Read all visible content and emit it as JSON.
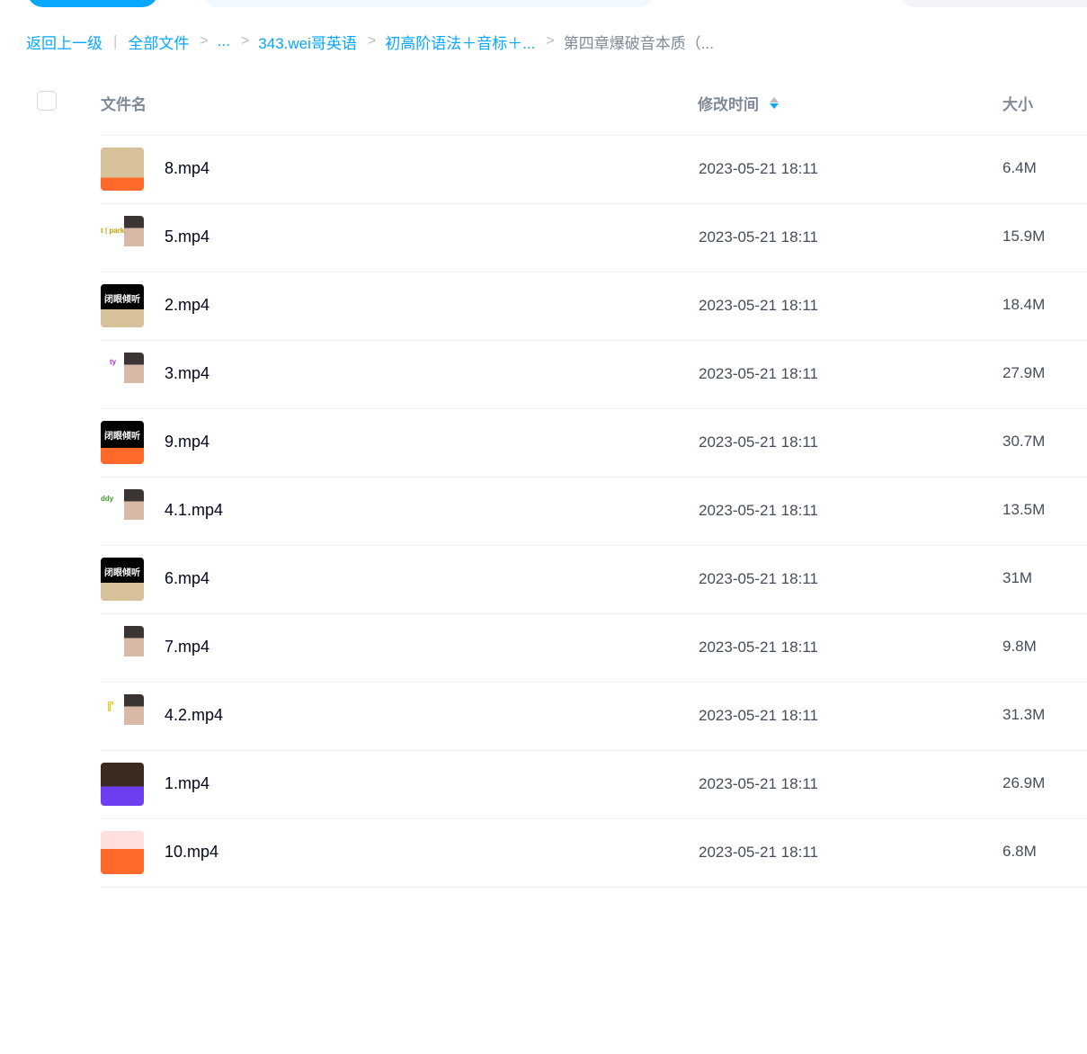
{
  "breadcrumb": {
    "back": "返回上一级",
    "pipe": "|",
    "sep": ">",
    "items": [
      "全部文件",
      "...",
      "343.wei哥英语",
      "初高阶语法＋音标＋..."
    ],
    "current": "第四章爆破音本质（..."
  },
  "header": {
    "name": "文件名",
    "time": "修改时间",
    "size": "大小"
  },
  "files": [
    {
      "name": "8.mp4",
      "time": "2023-05-21 18:11",
      "size": "6.4M"
    },
    {
      "name": "5.mp4",
      "time": "2023-05-21 18:11",
      "size": "15.9M"
    },
    {
      "name": "2.mp4",
      "time": "2023-05-21 18:11",
      "size": "18.4M"
    },
    {
      "name": "3.mp4",
      "time": "2023-05-21 18:11",
      "size": "27.9M"
    },
    {
      "name": "9.mp4",
      "time": "2023-05-21 18:11",
      "size": "30.7M"
    },
    {
      "name": "4.1.mp4",
      "time": "2023-05-21 18:11",
      "size": "13.5M"
    },
    {
      "name": "6.mp4",
      "time": "2023-05-21 18:11",
      "size": "31M"
    },
    {
      "name": "7.mp4",
      "time": "2023-05-21 18:11",
      "size": "9.8M"
    },
    {
      "name": "4.2.mp4",
      "time": "2023-05-21 18:11",
      "size": "31.3M"
    },
    {
      "name": "1.mp4",
      "time": "2023-05-21 18:11",
      "size": "26.9M"
    },
    {
      "name": "10.mp4",
      "time": "2023-05-21 18:11",
      "size": "6.8M"
    }
  ],
  "thumbs": {
    "black_text": "闭眼倾听",
    "word_5": "t | park",
    "word_3": "ty",
    "word_41": "ddy",
    "word_42": "『"
  },
  "colors": {
    "accent": "#06a7ff",
    "muted": "#818999",
    "text": "#03081a"
  }
}
